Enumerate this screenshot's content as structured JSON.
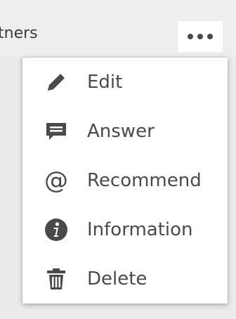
{
  "header": {
    "title": "tners"
  },
  "more_button": {
    "icon": "more-horizontal-icon"
  },
  "menu": {
    "items": [
      {
        "label": "Edit",
        "icon": "pencil-icon"
      },
      {
        "label": "Answer",
        "icon": "comment-icon"
      },
      {
        "label": "Recommend",
        "icon": "at-sign-icon",
        "glyph": "@"
      },
      {
        "label": "Information",
        "icon": "info-icon"
      },
      {
        "label": "Delete",
        "icon": "trash-icon"
      }
    ]
  },
  "colors": {
    "text": "#4a4a4a",
    "menu_bg": "#ffffff",
    "page_bg": "#ececec"
  }
}
